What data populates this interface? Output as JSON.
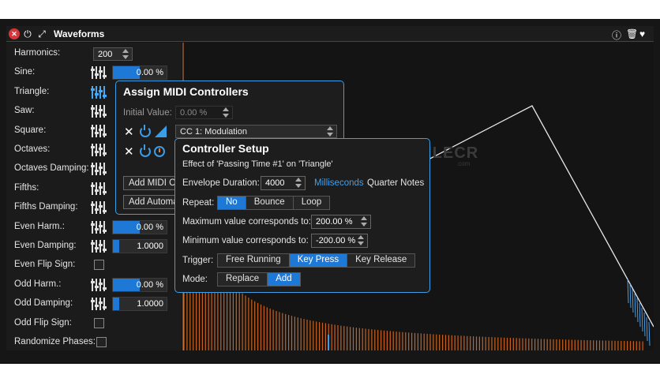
{
  "window": {
    "title": "Waveforms"
  },
  "params": [
    {
      "label": "Harmonics:",
      "kind": "number",
      "value": "200"
    },
    {
      "label": "Sine:",
      "kind": "slider",
      "value": "0.00 %",
      "fill": 0.5
    },
    {
      "label": "Triangle:",
      "kind": "slider",
      "value": "",
      "fill": 0,
      "highlight": true
    },
    {
      "label": "Saw:",
      "kind": "slider",
      "value": "",
      "fill": 0
    },
    {
      "label": "Square:",
      "kind": "slider",
      "value": "",
      "fill": 0
    },
    {
      "label": "Octaves:",
      "kind": "slider",
      "value": "",
      "fill": 0
    },
    {
      "label": "Octaves Damping:",
      "kind": "slider",
      "value": "",
      "fill": 0
    },
    {
      "label": "Fifths:",
      "kind": "slider",
      "value": "",
      "fill": 0
    },
    {
      "label": "Fifths Damping:",
      "kind": "slider",
      "value": "",
      "fill": 0
    },
    {
      "label": "Even Harm.:",
      "kind": "slider",
      "value": "0.00 %",
      "fill": 0.5
    },
    {
      "label": "Even Damping:",
      "kind": "slider",
      "value": "1.0000",
      "fill": 0.12
    },
    {
      "label": "Even Flip Sign:",
      "kind": "check"
    },
    {
      "label": "Odd Harm.:",
      "kind": "slider",
      "value": "0.00 %",
      "fill": 0.5
    },
    {
      "label": "Odd Damping:",
      "kind": "slider",
      "value": "1.0000",
      "fill": 0.12
    },
    {
      "label": "Odd Flip Sign:",
      "kind": "check"
    },
    {
      "label": "Randomize Phases:",
      "kind": "check"
    }
  ],
  "midi": {
    "title": "Assign MIDI Controllers",
    "initial_label": "Initial Value:",
    "initial_value": "0.00 %",
    "cc_value": "CC 1: Modulation",
    "btn_add_midi": "Add MIDI C",
    "btn_add_auto": "Add Automa"
  },
  "ctrl": {
    "title": "Controller Setup",
    "subtitle": "Effect of 'Passing Time #1' on 'Triangle'",
    "env_label": "Envelope Duration:",
    "env_value": "4000",
    "env_unit_ms": "Milliseconds",
    "env_unit_qn": "Quarter Notes",
    "repeat_label": "Repeat:",
    "repeat_opts": [
      "No",
      "Bounce",
      "Loop"
    ],
    "repeat_sel": 0,
    "max_label": "Maximum value corresponds to:",
    "max_value": "200.00 %",
    "min_label": "Minimum value corresponds to:",
    "min_value": "-200.00 %",
    "trigger_label": "Trigger:",
    "trigger_opts": [
      "Free Running",
      "Key Press",
      "Key Release"
    ],
    "trigger_sel": 1,
    "mode_label": "Mode:",
    "mode_opts": [
      "Replace",
      "Add"
    ],
    "mode_sel": 1
  },
  "watermark": {
    "text": "FILECR",
    "sub": ".com"
  },
  "colors": {
    "accent": "#1e78d6",
    "border_blue": "#3c9ee6",
    "spectrum": "#c8621e",
    "close_red": "#d8353a"
  },
  "icons": [
    "close-icon",
    "power-icon",
    "expand-icon",
    "info-icon",
    "trash-icon",
    "heart-icon",
    "sliders-icon",
    "chevron-updown-icon"
  ]
}
